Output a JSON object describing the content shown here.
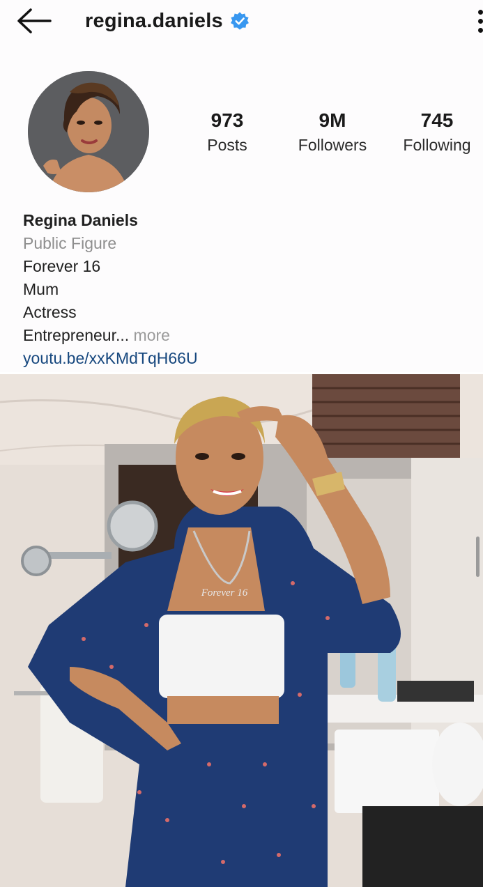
{
  "header": {
    "back_icon": "arrow-left-icon",
    "username": "regina.daniels",
    "verified_icon": "verified-badge-icon",
    "verified_color": "#3897f0",
    "menu_icon": "more-vertical-icon"
  },
  "profile": {
    "avatar_icon": "profile-photo",
    "stats": [
      {
        "value": "973",
        "label": "Posts"
      },
      {
        "value": "9M",
        "label": "Followers"
      },
      {
        "value": "745",
        "label": "Following"
      }
    ],
    "bio": {
      "name": "Regina Daniels",
      "category": "Public Figure",
      "lines": [
        "Forever 16",
        "Mum",
        "Actress"
      ],
      "last_line": "Entrepreneur...",
      "more_label": "more",
      "link": "youtu.be/xxKMdTqH66U",
      "link_color": "#16477e"
    }
  },
  "post": {
    "pendant_text": "Forever 16"
  }
}
